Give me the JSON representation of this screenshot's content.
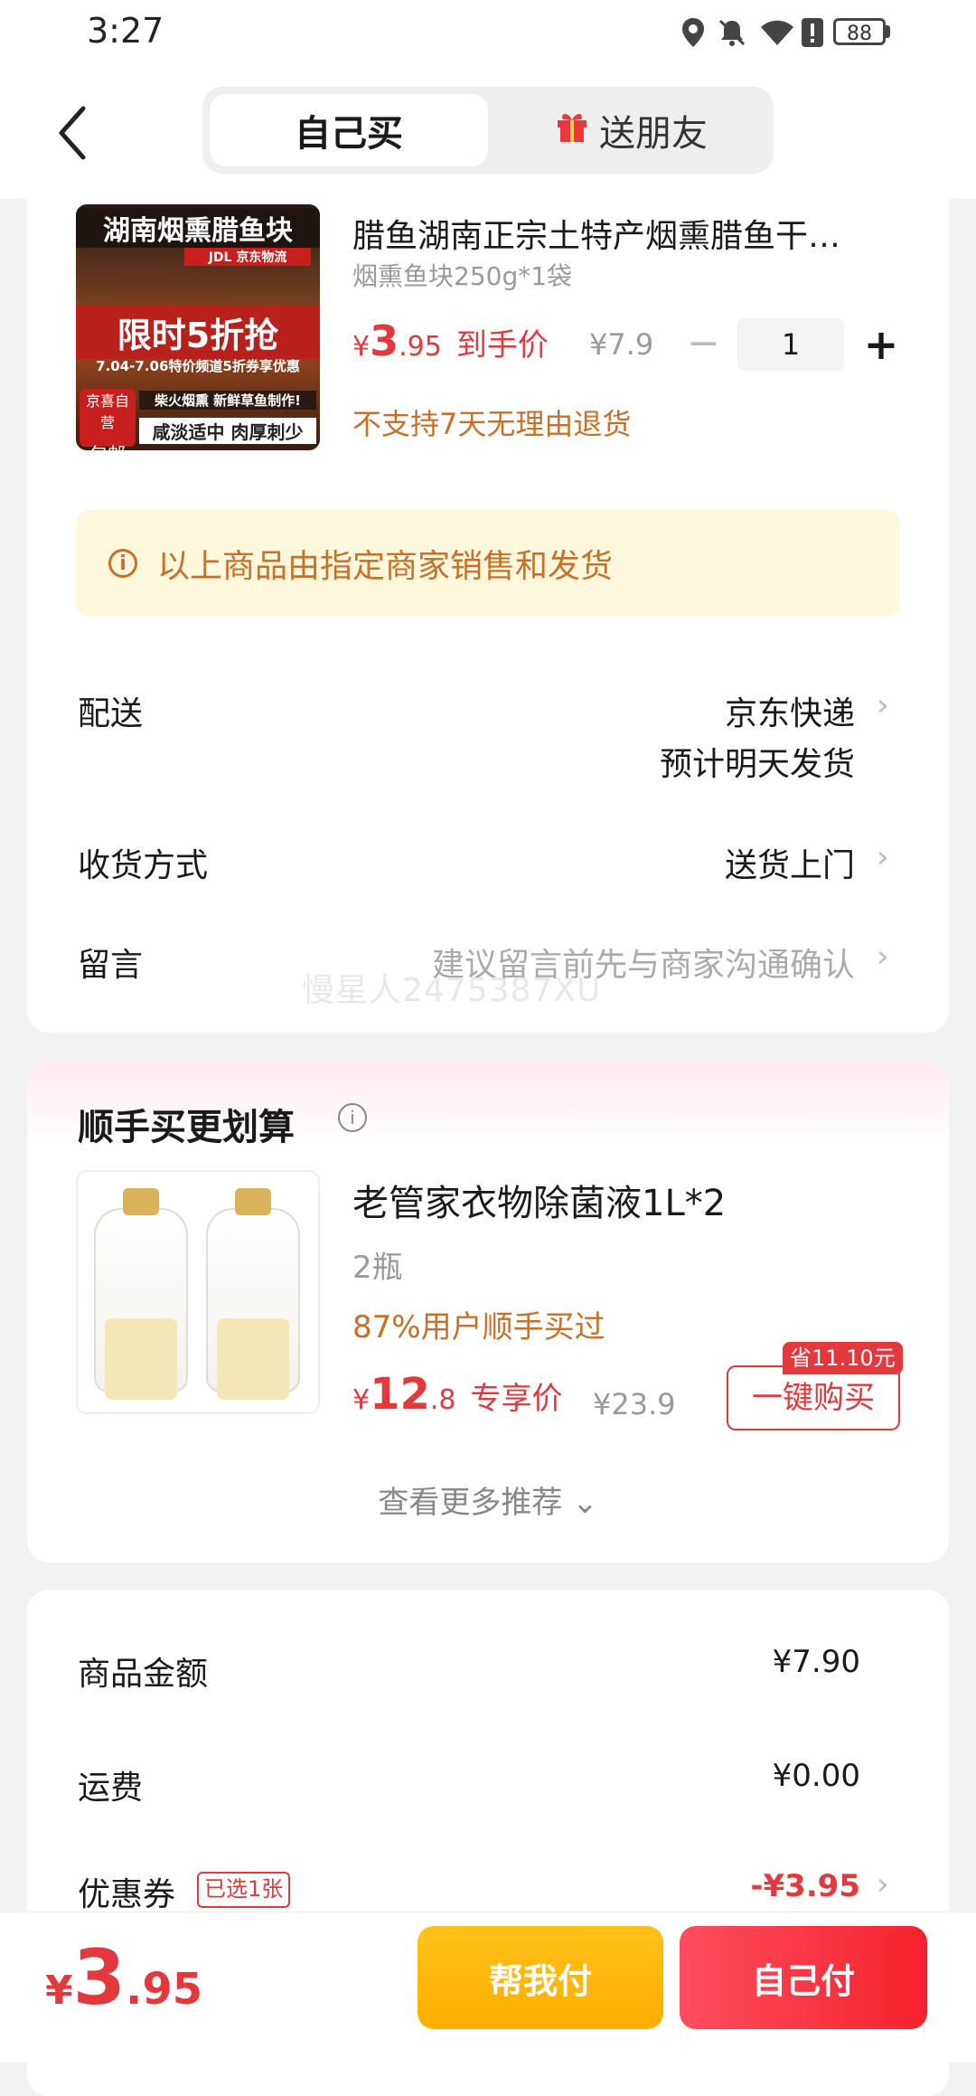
{
  "status_bar": {
    "time": "3:27",
    "battery": "88"
  },
  "header": {
    "tab_self": "自己买",
    "tab_gift": "送朋友"
  },
  "product": {
    "image_text": {
      "headline": "湖南烟熏腊鱼块",
      "brand": "JDL 京东物流",
      "promo": "限时5折抢",
      "promo_sub": "7.04-7.06特价频道5折券享优惠",
      "badge_top": "京喜自营",
      "badge_bottom": "包邮",
      "tag1": "柴火烟熏 新鲜草鱼制作!",
      "tag2": "咸淡适中 肉厚刺少"
    },
    "title": "腊鱼湖南正宗土特产烟熏腊鱼干…",
    "spec": "烟熏鱼块250g*1袋",
    "price_currency": "¥",
    "price_int": "3",
    "price_dec": ".95",
    "price_label": "到手价",
    "original_price": "¥7.9",
    "quantity": "1",
    "qty_minus": "−",
    "qty_plus": "+",
    "return_policy": "不支持7天无理由退货"
  },
  "notice": {
    "icon": "i",
    "text": "以上商品由指定商家销售和发货"
  },
  "delivery": {
    "label": "配送",
    "carrier": "京东快递",
    "eta": "预计明天发货",
    "receive_label": "收货方式",
    "receive_value": "送货上门",
    "message_label": "留言",
    "message_placeholder": "建议留言前先与商家沟通确认"
  },
  "watermark": "慢星人2475387XU",
  "recommend": {
    "title": "顺手买更划算",
    "info_icon": "i",
    "item_title": "老管家衣物除菌液1L*2",
    "item_sub": "2瓶",
    "item_pct": "87%用户顺手买过",
    "price_currency": "¥",
    "price_int": "12",
    "price_dec": ".8",
    "price_label": "专享价",
    "original_price": "¥23.9",
    "save_badge": "省11.10元",
    "buy_button": "一键购买",
    "more": "查看更多推荐"
  },
  "summary": {
    "goods_label": "商品金额",
    "goods_value": "¥7.90",
    "shipping_label": "运费",
    "shipping_value": "¥0.00",
    "coupon_label": "优惠券",
    "coupon_tag": "已选1张",
    "coupon_value": "-¥3.95"
  },
  "bottom": {
    "currency": "¥",
    "total_int": "3",
    "total_dec": ".95",
    "help_button": "帮我付",
    "self_button": "自己付"
  },
  "colors": {
    "accent": "#e4393c",
    "warning": "#c8702a",
    "help": "#ffb800"
  }
}
